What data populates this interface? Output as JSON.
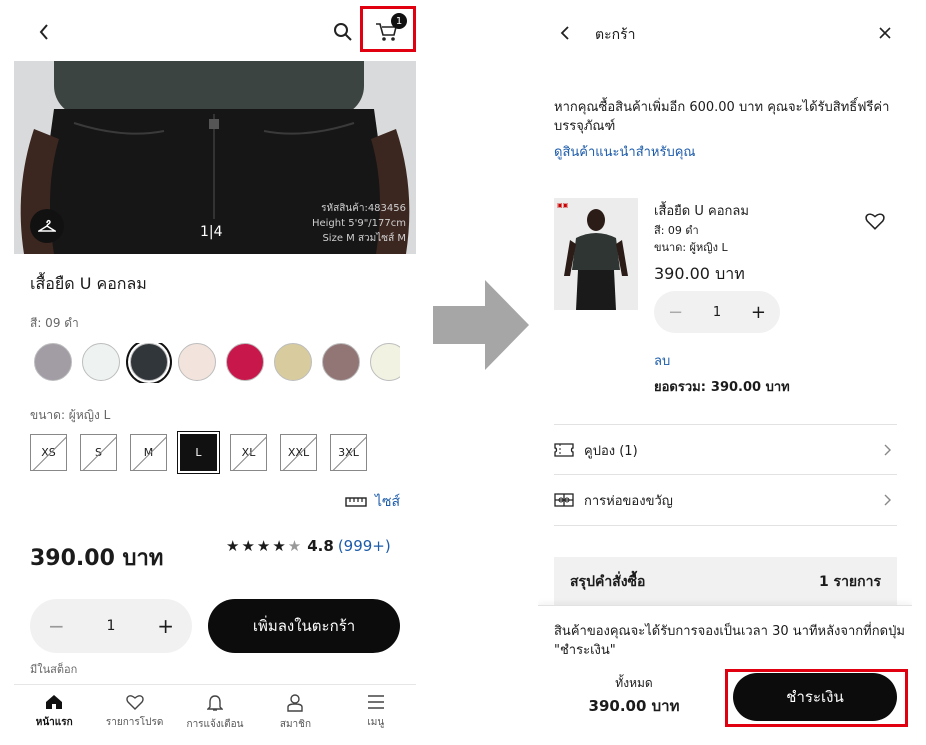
{
  "left": {
    "cart_count": "1",
    "hero": {
      "pager": "1|4",
      "meta_lines": [
        "รหัสสินค้า:483456",
        "Height 5'9\"/177cm",
        "Size M  สวมไซส์ M"
      ]
    },
    "product_title": "เสื้อยืด U คอกลม",
    "color_label": "สี: 09 ดำ",
    "swatches": [
      "#a29ca5",
      "#eef3f2",
      "#30363a",
      "#f2e4dc",
      "#c7174b",
      "#d8cc9f",
      "#927676",
      "#f1f2e2"
    ],
    "size_label": "ขนาด: ผู้หญิง L",
    "sizes": [
      "XS",
      "S",
      "M",
      "L",
      "XL",
      "XXL",
      "3XL"
    ],
    "size_guide": "ไซส์",
    "price": "390.00 บาท",
    "rating": "4.8",
    "rating_count": "(999+)",
    "qty": "1",
    "add_to_cart": "เพิ่มลงในตะกร้า",
    "stock": "มีในสต็อก",
    "tabs": [
      "หน้าแรก",
      "รายการโปรด",
      "การแจ้งเตือน",
      "สมาชิก",
      "เมนู"
    ]
  },
  "right": {
    "title": "ตะกร้า",
    "free_shipping_line1": "หากคุณซื้อสินค้าเพิ่มอีก 600.00 บาท คุณจะได้รับสิทธิ์ฟรีค่า",
    "free_shipping_line2": "บรรจุภัณฑ์",
    "recommend_link": "ดูสินค้าแนะนำสำหรับคุณ",
    "item": {
      "name": "เสื้อยืด U คอกลม",
      "color": "สี: 09 ดำ",
      "size": "ขนาด: ผู้หญิง L",
      "price": "390.00 บาท",
      "qty": "1",
      "remove": "ลบ",
      "subtotal_label": "ยอดรวม:",
      "subtotal_value": "390.00 บาท"
    },
    "coupon": "คูปอง (1)",
    "gift": "การห่อของขวัญ",
    "summary_label": "สรุปคำสั่งซื้อ",
    "summary_count": "1 รายการ",
    "reserve_line1": "สินค้าของคุณจะได้รับการจองเป็นเวลา 30 นาทีหลังจากที่กดปุ่ม",
    "reserve_line2": "\"ชำระเงิน\"",
    "total_label": "ทั้งหมด",
    "total_value": "390.00 บาท",
    "checkout": "ชำระเงิน"
  },
  "colors": {
    "highlight": "#e0000f",
    "link": "#1d5cab",
    "black": "#0c0c0c"
  }
}
